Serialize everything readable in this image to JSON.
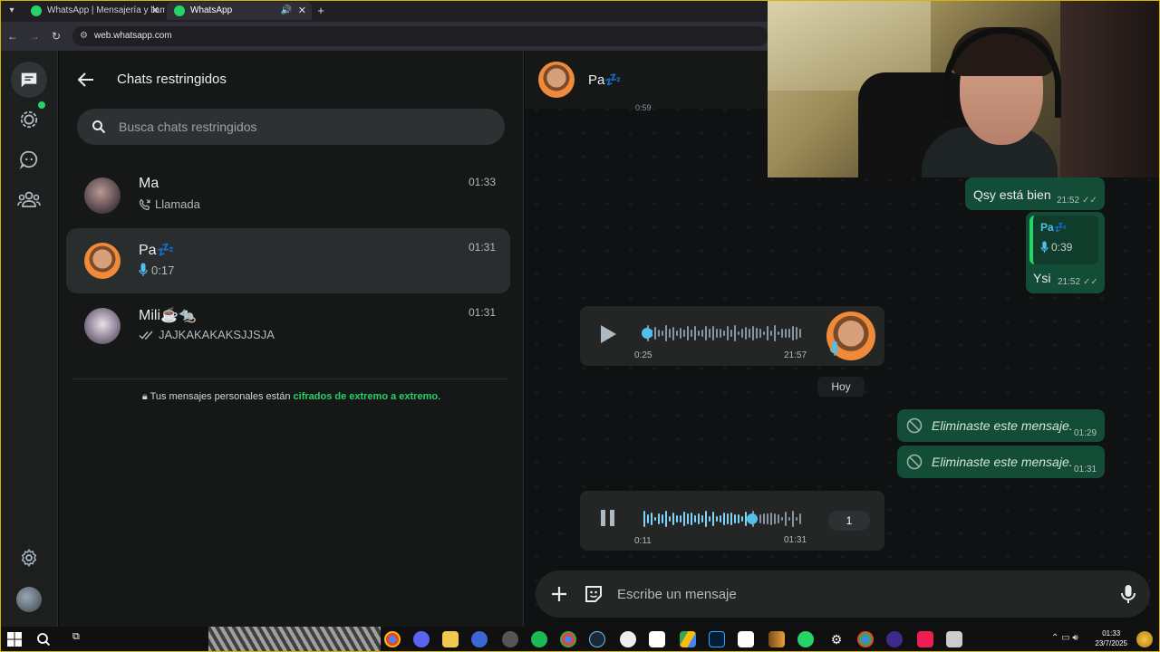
{
  "browser": {
    "tabs": [
      {
        "label": "WhatsApp | Mensajería y llama",
        "active": false
      },
      {
        "label": "WhatsApp",
        "active": true
      }
    ],
    "url": "web.whatsapp.com"
  },
  "sidepanel": {
    "title": "Chats restringidos",
    "search_placeholder": "Busca chats restringidos",
    "chats": [
      {
        "name": "Ma",
        "time": "01:33",
        "preview": "Llamada",
        "preview_icon": "call-icon"
      },
      {
        "name": "Pa💤",
        "time": "01:31",
        "preview": "0:17",
        "preview_icon": "mic-icon",
        "active": true
      },
      {
        "name": "Mili☕🐀",
        "time": "01:31",
        "preview": "JAJKAKAKAKSJJSJA",
        "preview_icon": "double-check-icon"
      }
    ],
    "encryption_note": {
      "prefix": "Tus mensajes personales están ",
      "link": "cifrados de extremo a extremo",
      "suffix": "."
    }
  },
  "conversation": {
    "contact_name": "Pa💤",
    "partial_time": "0:59",
    "messages": [
      {
        "text": "Qsy está bien",
        "time": "21:52"
      },
      {
        "quote_name": "Pa💤",
        "quote_duration": "0:39",
        "text": "Ysi",
        "time": "21:52"
      },
      {
        "type": "voice",
        "duration": "0:25",
        "time": "21:57",
        "progress": 0.0
      },
      {
        "text": "Eliminaste este mensaje.",
        "time": "01:29"
      },
      {
        "text": "Eliminaste este mensaje.",
        "time": "01:31"
      },
      {
        "type": "voice",
        "duration": "0:11",
        "time": "01:31",
        "progress": 0.65,
        "speed": "1"
      }
    ],
    "day_separator": "Hoy",
    "composer_placeholder": "Escribe un mensaje"
  },
  "taskbar": {
    "time": "01:33",
    "date": "23/7/2025"
  },
  "colors": {
    "accent": "#25d366",
    "outgoing_bubble": "#144d37",
    "incoming_bubble": "#242626",
    "panel": "#161717"
  }
}
